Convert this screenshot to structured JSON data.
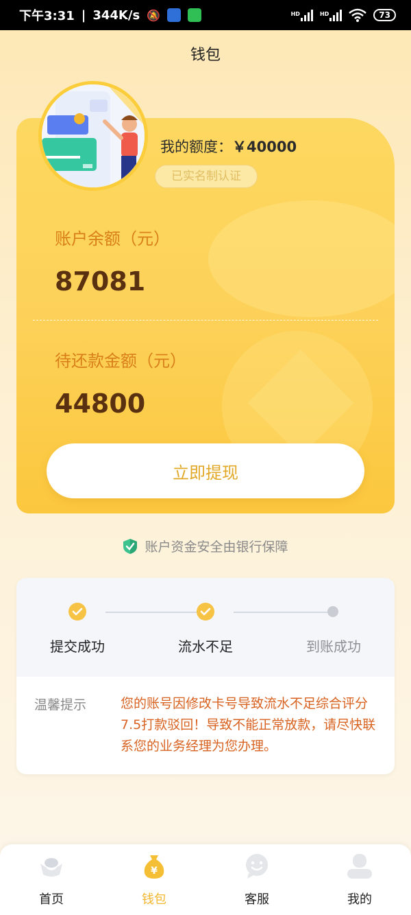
{
  "status_bar": {
    "time": "下午3:31",
    "speed": "344K/s",
    "battery": "73"
  },
  "header": {
    "title": "钱包"
  },
  "card": {
    "quota_label": "我的额度：",
    "quota_value": "￥40000",
    "verify_badge": "已实名制认证",
    "balance_label": "账户余额（元）",
    "balance_value": "87081",
    "repay_label": "待还款金额（元）",
    "repay_value": "44800",
    "withdraw_button": "立即提现"
  },
  "security_note": "账户资金安全由银行保障",
  "progress": {
    "steps": [
      {
        "label": "提交成功",
        "status": "done"
      },
      {
        "label": "流水不足",
        "status": "done"
      },
      {
        "label": "到账成功",
        "status": "pending"
      }
    ],
    "tip_title": "温馨提示",
    "tip_text": "您的账号因修改卡号导致流水不足综合评分7.5打款驳回！导致不能正常放款，请尽快联系您的业务经理为您办理。"
  },
  "tabs": [
    {
      "label": "首页",
      "icon": "ingot-icon",
      "active": false
    },
    {
      "label": "钱包",
      "icon": "money-bag-icon",
      "active": true
    },
    {
      "label": "客服",
      "icon": "chat-smile-icon",
      "active": false
    },
    {
      "label": "我的",
      "icon": "user-icon",
      "active": false
    }
  ],
  "colors": {
    "accent": "#f3b72e",
    "warning_text": "#d86220",
    "card_yellow": "#fdd159"
  }
}
